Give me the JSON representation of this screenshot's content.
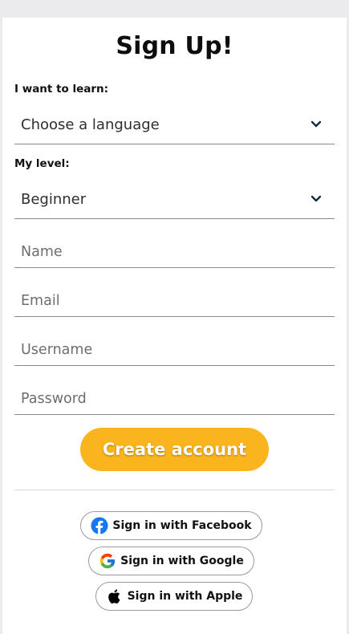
{
  "form": {
    "title": "Sign Up!",
    "learn_label": "I want to learn:",
    "language_select": {
      "value": "Choose a language"
    },
    "level_label": "My level:",
    "level_select": {
      "value": "Beginner"
    },
    "name_placeholder": "Name",
    "email_placeholder": "Email",
    "username_placeholder": "Username",
    "password_placeholder": "Password",
    "submit_label": "Create account",
    "submit_color": "#fab51e"
  },
  "social": [
    {
      "label": "Sign in with Facebook",
      "icon": "facebook-icon"
    },
    {
      "label": "Sign in with Google",
      "icon": "google-icon"
    },
    {
      "label": "Sign in with Apple",
      "icon": "apple-icon"
    }
  ]
}
